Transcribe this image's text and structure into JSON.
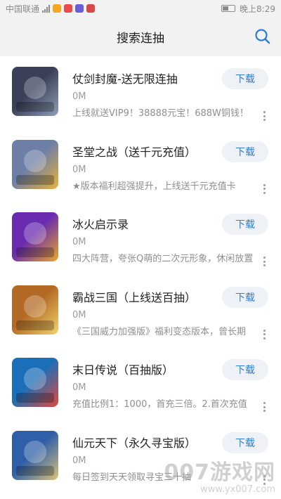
{
  "status_bar": {
    "carrier": "中国联通",
    "time": "晚上8:29",
    "colors": {
      "icon_a": "#f5a623",
      "icon_b": "#e94b4b",
      "icon_c": "#6b5bd6",
      "icon_d": "#d94848"
    }
  },
  "header": {
    "title": "搜索连抽",
    "search_icon": "search-icon",
    "accent": "#2e7bd6"
  },
  "apps": [
    {
      "title": "仗剑封魔-送无限连抽",
      "size": "0M",
      "desc": "上线就送VIP9！38888元宝！688W铜钱！",
      "download_label": "下载",
      "thumb_colors": [
        "#3b3f5a",
        "#8ea0b6"
      ]
    },
    {
      "title": "圣堂之战（送千元充值）",
      "size": "0M",
      "desc": "★版本福利超强提升，上线送千元充值卡",
      "download_label": "下载",
      "thumb_colors": [
        "#6e7fa6",
        "#e8b13a"
      ]
    },
    {
      "title": "冰火启示录",
      "size": "0M",
      "desc": "四大阵营，夸张Q萌的二次元形象，休闲放置",
      "download_label": "下载",
      "thumb_colors": [
        "#6a2bb0",
        "#e9a92a"
      ]
    },
    {
      "title": "霸战三国（上线送百抽）",
      "size": "0M",
      "desc": "《三国威力加强版》福利变态版本，曾长期",
      "download_label": "下载",
      "thumb_colors": [
        "#b46a25",
        "#f2d36b"
      ]
    },
    {
      "title": "末日传说（百抽版）",
      "size": "0M",
      "desc": "充值比例1：1000，首充三倍。2.首次充值",
      "download_label": "下载",
      "thumb_colors": [
        "#1b6fb8",
        "#e0483b"
      ]
    },
    {
      "title": "仙元天下（永久寻宝版）",
      "size": "0M",
      "desc": "每日签到天天领取寻宝三十抽",
      "download_label": "下载",
      "thumb_colors": [
        "#2f5fa8",
        "#d9c27a"
      ]
    }
  ],
  "watermark": {
    "big": "007游戏网",
    "url": "www.yx007.com"
  }
}
